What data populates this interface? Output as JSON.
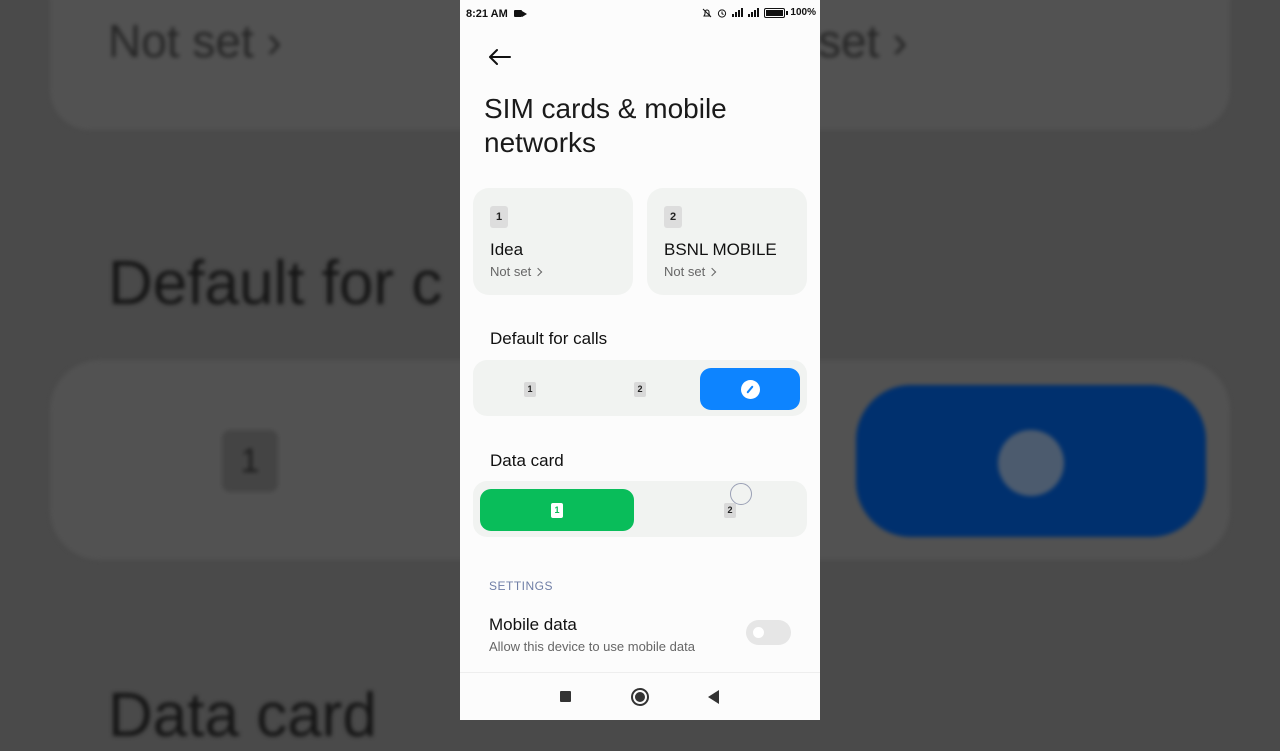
{
  "status_bar": {
    "time": "8:21 AM",
    "battery_pct": "100",
    "icons": [
      "video-camera-icon",
      "mute-icon",
      "alarm-icon",
      "signal-icon",
      "signal-icon",
      "battery-icon"
    ]
  },
  "page": {
    "title": "SIM cards & mobile networks",
    "back_icon": "arrow-left-icon"
  },
  "sims": [
    {
      "slot": "1",
      "name": "Idea",
      "status": "Not set"
    },
    {
      "slot": "2",
      "name": "BSNL MOBILE",
      "status": "Not set"
    }
  ],
  "default_calls": {
    "label": "Default for calls",
    "options": [
      "1",
      "2",
      "ask-every-time"
    ],
    "selected": "ask-every-time",
    "accent": "#0d84ff"
  },
  "data_card": {
    "label": "Data card",
    "options": [
      "1",
      "2"
    ],
    "selected": "1",
    "accent": "#09bd5a"
  },
  "settings": {
    "section_label": "SETTINGS",
    "mobile_data": {
      "title": "Mobile data",
      "subtitle": "Allow this device to use mobile data",
      "enabled": false
    }
  },
  "background": {
    "not_set": "Not set",
    "not_set_partial": "set",
    "default_partial": "Default for c",
    "sim_slot": "1",
    "data_partial": "Data card"
  }
}
